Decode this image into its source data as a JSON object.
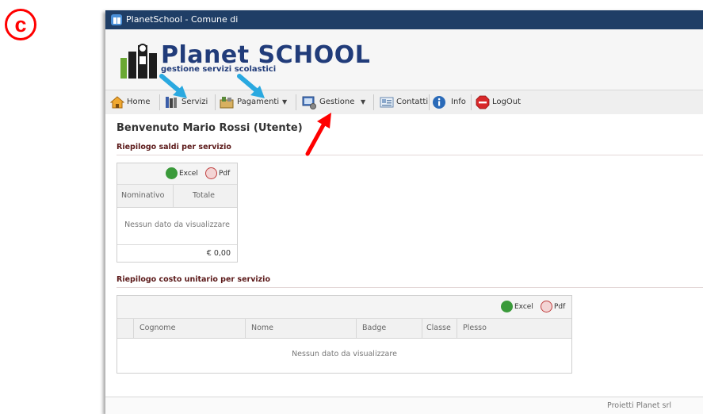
{
  "marker": {
    "letter": "c"
  },
  "window": {
    "title": "PlanetSchool - Comune di"
  },
  "header": {
    "brand": "Planet SCHOOL",
    "tagline": "gestione servizi scolastici"
  },
  "toolbar": {
    "items": [
      {
        "label": "Home",
        "icon": "home-icon"
      },
      {
        "label": "Servizi",
        "icon": "books-icon"
      },
      {
        "label": "Pagamenti",
        "icon": "payments-icon"
      },
      {
        "label": "Gestione",
        "icon": "management-icon"
      },
      {
        "label": "Contatti",
        "icon": "contacts-icon"
      },
      {
        "label": "Info",
        "icon": "info-icon"
      },
      {
        "label": "LogOut",
        "icon": "stop-icon"
      }
    ]
  },
  "content": {
    "welcome": "Benvenuto Mario Rossi (Utente)",
    "section1": {
      "title": "Riepilogo saldi per servizio",
      "export_excel": "Excel",
      "export_pdf": "Pdf",
      "columns": [
        "Nominativo",
        "Totale"
      ],
      "empty": "Nessun dato da visualizzare",
      "total": "€ 0,00"
    },
    "section2": {
      "title": "Riepilogo costo unitario per servizio",
      "export_excel": "Excel",
      "export_pdf": "Pdf",
      "columns": [
        "Cognome",
        "Nome",
        "Badge",
        "Classe",
        "Plesso"
      ],
      "empty": "Nessun dato da visualizzare"
    }
  },
  "footer": {
    "text": "Proietti Planet srl"
  },
  "colors": {
    "titlebar": "#1f3e66",
    "brand": "#213c7a",
    "annotation_red": "#ff0000",
    "annotation_blue": "#2aa9e0"
  }
}
